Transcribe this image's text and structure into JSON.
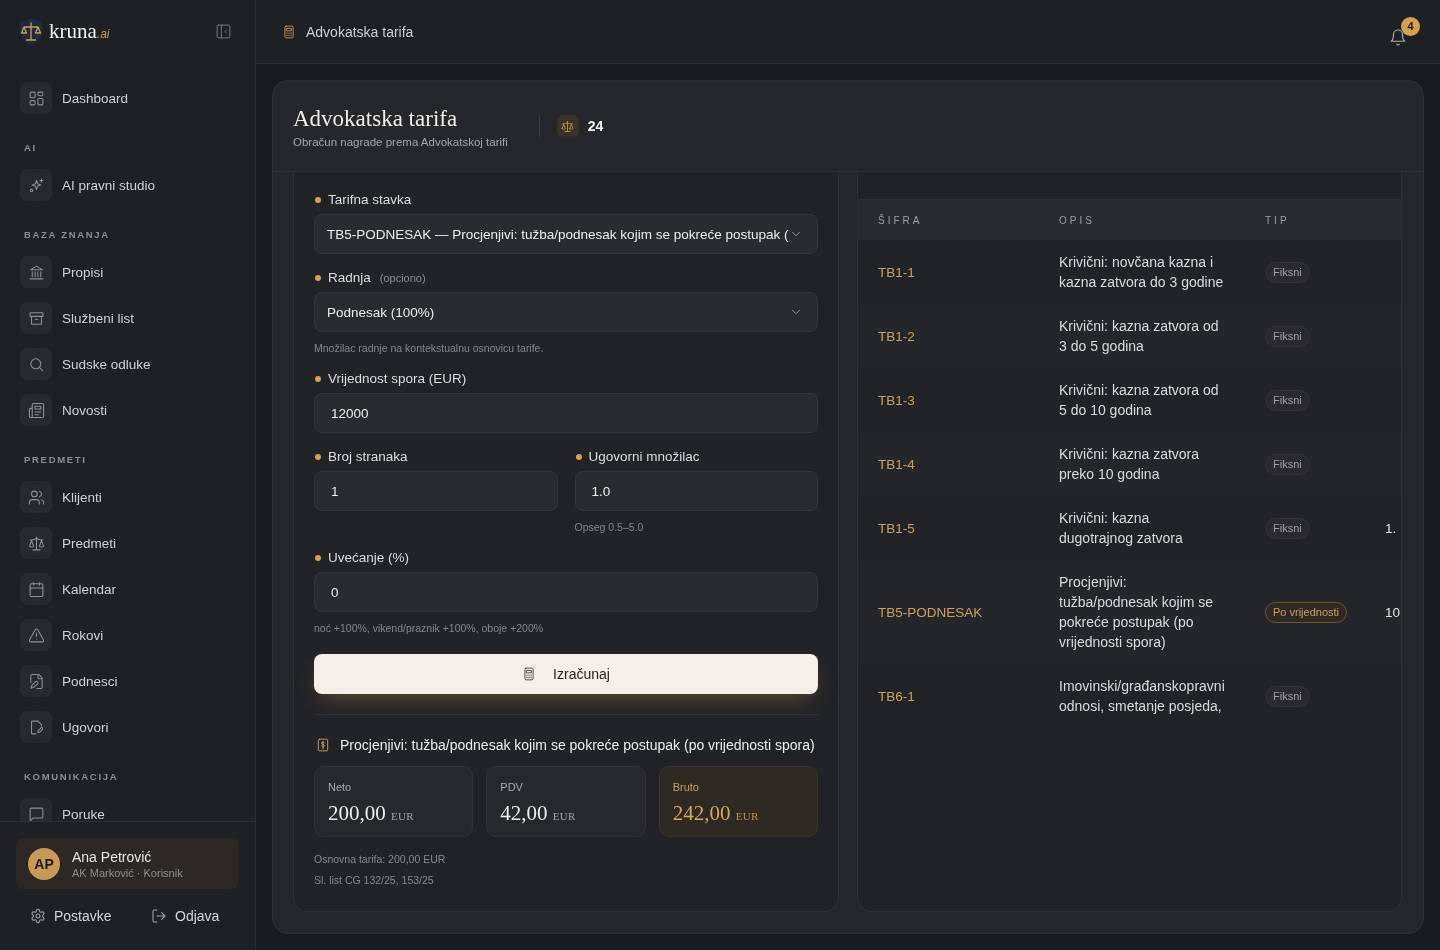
{
  "sidebar": {
    "logo": {
      "name": "kruna",
      "suffix": ".ai"
    },
    "sections": [
      {
        "items": [
          {
            "label": "Dashboard",
            "selected": false
          }
        ]
      },
      {
        "heading": "AI",
        "items": [
          {
            "label": "AI pravni studio",
            "selected": false
          }
        ]
      },
      {
        "heading": "BAZA ZNANJA",
        "items": [
          {
            "label": "Propisi",
            "selected": false
          },
          {
            "label": "Službeni list",
            "selected": false
          },
          {
            "label": "Sudske odluke",
            "selected": false
          },
          {
            "label": "Novosti",
            "selected": false
          }
        ]
      },
      {
        "heading": "PREDMETI",
        "items": [
          {
            "label": "Klijenti",
            "selected": false
          },
          {
            "label": "Predmeti",
            "selected": false
          },
          {
            "label": "Kalendar",
            "selected": false
          },
          {
            "label": "Rokovi",
            "selected": false
          },
          {
            "label": "Podnesci",
            "selected": false
          },
          {
            "label": "Ugovori",
            "selected": false
          }
        ]
      },
      {
        "heading": "KOMUNIKACIJA",
        "items": [
          {
            "label": "Poruke",
            "selected": false
          }
        ]
      }
    ],
    "user": {
      "initials": "AP",
      "name": "Ana Petrović",
      "subtitle": "AK Marković · Korisnik"
    },
    "footer_links": [
      "Postavke",
      "Odjava"
    ]
  },
  "topbar": {
    "title": "Advokatska tarifa",
    "notification_count": "4"
  },
  "page": {
    "title": "Advokatska tarifa",
    "subtitle": "Obračun nagrade prema Advokatskoj tarifi",
    "stat": "24"
  },
  "form": {
    "fields": [
      {
        "kind": "select",
        "label": "Tarifna stavka",
        "value": "TB5-PODNESAK — Procjenjivi: tužba/podnesak kojim se pokreće postupak ("
      },
      {
        "kind": "select",
        "label": "Radnja",
        "note": "(opciono)",
        "value": "Podnesak (100%)",
        "hint": "Množilac radnje na kontekstualnu osnovicu tarife."
      },
      {
        "kind": "input",
        "label": "Vrijednost spora (EUR)",
        "value": "12000"
      },
      {
        "kind": "pair",
        "fields": [
          {
            "kind": "input",
            "label": "Broj stranaka",
            "value": "1"
          },
          {
            "kind": "input",
            "label": "Ugovorni množilac",
            "value": "1.0",
            "hint": "Opseg 0.5–5.0"
          }
        ]
      },
      {
        "kind": "input",
        "label": "Uvećanje (%)",
        "value": "0",
        "hint": "noć +100%, vikend/praznik +100%, oboje +200%"
      }
    ],
    "button": "Izračunaj"
  },
  "result": {
    "title": "Procjenjivi: tužba/podnesak kojim se pokreće postupak (po vrijednosti spora)",
    "amounts": [
      {
        "label": "Neto",
        "value": "200,00",
        "currency": "EUR",
        "highlighted": false
      },
      {
        "label": "PDV",
        "value": "42,00",
        "currency": "EUR",
        "highlighted": false
      },
      {
        "label": "Bruto",
        "value": "242,00",
        "currency": "EUR",
        "highlighted": true
      }
    ],
    "notes": [
      "Osnovna tarifa: 200,00 EUR",
      "Sl. list CG 132/25, 153/25"
    ]
  },
  "table": {
    "columns": [
      "ŠIFRA",
      "OPIS",
      "TIP"
    ],
    "rows": [
      {
        "code": "TB1-1",
        "description": "Krivični: novčana kazna i kazna zatvora do 3 godine",
        "tag": {
          "label": "Fiksni",
          "kind": "fixed"
        }
      },
      {
        "code": "TB1-2",
        "description": "Krivični: kazna zatvora od 3 do 5 godina",
        "tag": {
          "label": "Fiksni",
          "kind": "fixed"
        }
      },
      {
        "code": "TB1-3",
        "description": "Krivični: kazna zatvora od 5 do 10 godina",
        "tag": {
          "label": "Fiksni",
          "kind": "fixed"
        }
      },
      {
        "code": "TB1-4",
        "description": "Krivični: kazna zatvora preko 10 godina",
        "tag": {
          "label": "Fiksni",
          "kind": "fixed"
        }
      },
      {
        "code": "TB1-5",
        "description": "Krivični: kazna dugotrajnog zatvora",
        "tag": {
          "label": "Fiksni",
          "kind": "fixed"
        },
        "column_4": "1."
      },
      {
        "code": "TB5-PODNESAK",
        "description": "Procjenjivi: tužba/podnesak kojim se pokreće postupak (po vrijednosti spora)",
        "tag": {
          "label": "Po vrijednosti",
          "kind": "value"
        },
        "column_4": "10"
      },
      {
        "code": "TB6-1",
        "description": "Imovinski/građanskopravni odnosi, smetanje posjeda,",
        "tag": {
          "label": "Fiksni",
          "kind": "fixed"
        }
      }
    ]
  }
}
